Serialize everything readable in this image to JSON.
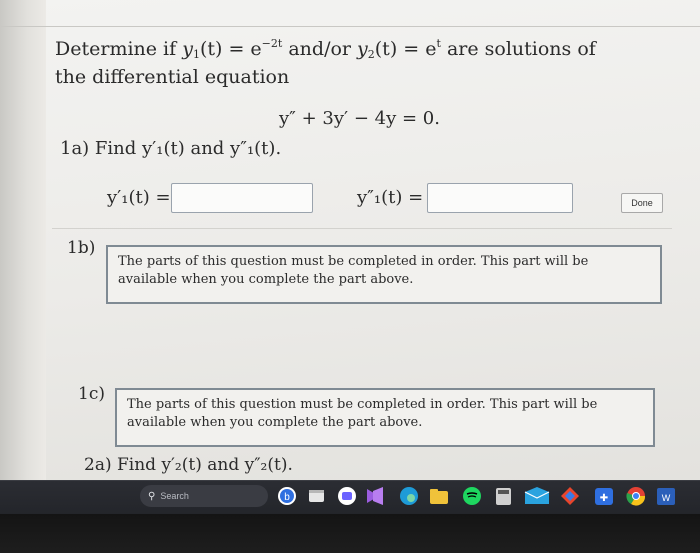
{
  "question": {
    "line1_prefix": "Determine if ",
    "line1_func1": "y",
    "line1_func1_sub": "1",
    "line1_eq1": "(t) = e",
    "line1_exp1": "−2t",
    "line1_mid": " and/or ",
    "line1_func2": "y",
    "line1_func2_sub": "2",
    "line1_eq2": "(t) = e",
    "line1_exp2": "t",
    "line1_suffix": " are solutions of",
    "line2": "the differential equation",
    "equation": "y″ + 3y′ − 4y = 0."
  },
  "part_1a": {
    "label": "1a) Find y′₁(t) and y″₁(t).",
    "y1p_label": "y′₁(t) =",
    "y1pp_label": "y″₁(t) =",
    "y1p_value": "",
    "y1pp_value": "",
    "done_label": "Done"
  },
  "part_1b": {
    "label": "1b)",
    "message": "The parts of this question must be completed in order. This part will be available when you complete the part above."
  },
  "part_1c": {
    "label": "1c)",
    "message": "The parts of this question must be completed in order. This part will be available when you complete the part above."
  },
  "part_2a": {
    "label": "2a) Find y′₂(t) and y″₂(t)."
  },
  "taskbar": {
    "search_placeholder": "Search",
    "icons": [
      {
        "name": "windows-start-icon"
      },
      {
        "name": "search-icon"
      },
      {
        "name": "bing-icon",
        "color": "#2f6fe0"
      },
      {
        "name": "file-explorer-icon",
        "color": "#e6e6e6"
      },
      {
        "name": "teams-chat-icon",
        "color": "#6c63ff"
      },
      {
        "name": "visual-studio-icon",
        "color": "#9c5de0"
      },
      {
        "name": "edge-icon",
        "color": "#1e9bd7"
      },
      {
        "name": "folder-icon",
        "color": "#f0c23a"
      },
      {
        "name": "spotify-icon",
        "color": "#1ed760"
      },
      {
        "name": "calculator-icon",
        "color": "#d0d0d0"
      },
      {
        "name": "mail-icon",
        "color": "#2aa3df"
      },
      {
        "name": "diamond-app-icon",
        "color": "#e8452c"
      },
      {
        "name": "dropbox-icon",
        "color": "#2f6fe0"
      },
      {
        "name": "chrome-icon",
        "color": "#e44134"
      },
      {
        "name": "word-icon",
        "color": "#2b5fb9"
      }
    ]
  }
}
